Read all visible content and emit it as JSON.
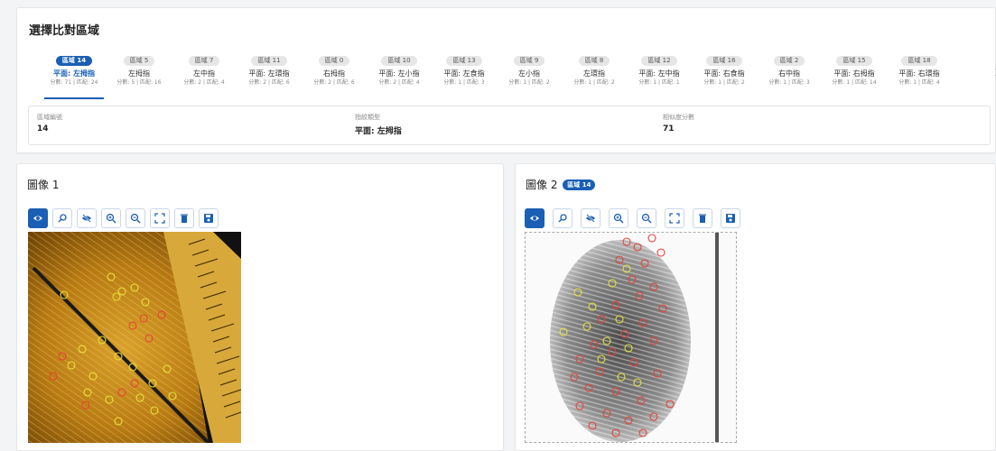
{
  "section_title": "選擇比對區域",
  "tabs": [
    {
      "badge": "區域 14",
      "finger": "平面: 左拇指",
      "meta": "分數: 71 | 匹配: 24",
      "active": true
    },
    {
      "badge": "區域 5",
      "finger": "左拇指",
      "meta": "分數: 5 | 匹配: 16"
    },
    {
      "badge": "區域 7",
      "finger": "左中指",
      "meta": "分數: 2 | 匹配: 4"
    },
    {
      "badge": "區域 11",
      "finger": "平面: 左環指",
      "meta": "分數: 2 | 匹配: 6"
    },
    {
      "badge": "區域 0",
      "finger": "右拇指",
      "meta": "分數: 2 | 匹配: 6"
    },
    {
      "badge": "區域 10",
      "finger": "平面: 左小指",
      "meta": "分數: 2 | 匹配: 4"
    },
    {
      "badge": "區域 13",
      "finger": "平面: 左食指",
      "meta": "分數: 1 | 匹配: 3"
    },
    {
      "badge": "區域 9",
      "finger": "左小指",
      "meta": "分數: 1 | 匹配: 2"
    },
    {
      "badge": "區域 8",
      "finger": "左環指",
      "meta": "分數: 1 | 匹配: 2"
    },
    {
      "badge": "區域 12",
      "finger": "平面: 左中指",
      "meta": "分數: 1 | 匹配: 1"
    },
    {
      "badge": "區域 16",
      "finger": "平面: 右食指",
      "meta": "分數: 1 | 匹配: 2"
    },
    {
      "badge": "區域 2",
      "finger": "右中指",
      "meta": "分數: 1 | 匹配: 3"
    },
    {
      "badge": "區域 15",
      "finger": "平面: 右拇指",
      "meta": "分數: 1 | 匹配: 14"
    },
    {
      "badge": "區域 18",
      "finger": "平面: 右環指",
      "meta": "分數: 1 | 匹配: 4"
    }
  ],
  "tabs_next_icon": "chevron-right-icon",
  "info": {
    "region_label": "區域編號",
    "region_value": "14",
    "type_label": "指紋類型",
    "type_value": "平面: 左拇指",
    "score_label": "相似度分數",
    "score_value": "71"
  },
  "panel1": {
    "title": "圖像 1"
  },
  "panel2": {
    "title": "圖像 2",
    "badge": "區域 14"
  },
  "toolbar_icons": [
    "eye-icon",
    "zoom-search-icon",
    "eye-off-icon",
    "zoom-in-icon",
    "zoom-out-icon",
    "fullscreen-icon",
    "trash-icon",
    "save-icon"
  ],
  "colors": {
    "primary": "#1a5fb4",
    "marker_yellow": "#e8e23a",
    "marker_red": "#e8403a"
  }
}
